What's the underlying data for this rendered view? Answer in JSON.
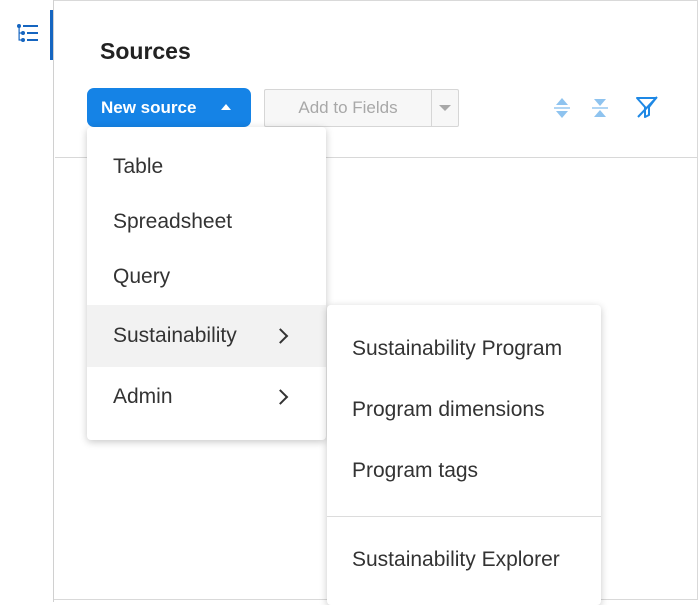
{
  "page": {
    "title": "Sources"
  },
  "rail": {
    "icon": "outline-list-icon"
  },
  "toolbar": {
    "new_source_label": "New source",
    "add_fields_label": "Add to Fields",
    "icons": [
      "expand-all-icon",
      "collapse-all-icon",
      "filter-off-icon"
    ],
    "accent_color": "#1583e6"
  },
  "menu": {
    "items": [
      {
        "label": "Table",
        "has_submenu": false
      },
      {
        "label": "Spreadsheet",
        "has_submenu": false
      },
      {
        "label": "Query",
        "has_submenu": false
      },
      {
        "label": "Sustainability",
        "has_submenu": true,
        "active": true
      },
      {
        "label": "Admin",
        "has_submenu": true
      }
    ]
  },
  "submenu": {
    "items": [
      {
        "label": "Sustainability Program"
      },
      {
        "label": "Program dimensions"
      },
      {
        "label": "Program tags"
      },
      {
        "label": "Sustainability Explorer"
      }
    ]
  }
}
